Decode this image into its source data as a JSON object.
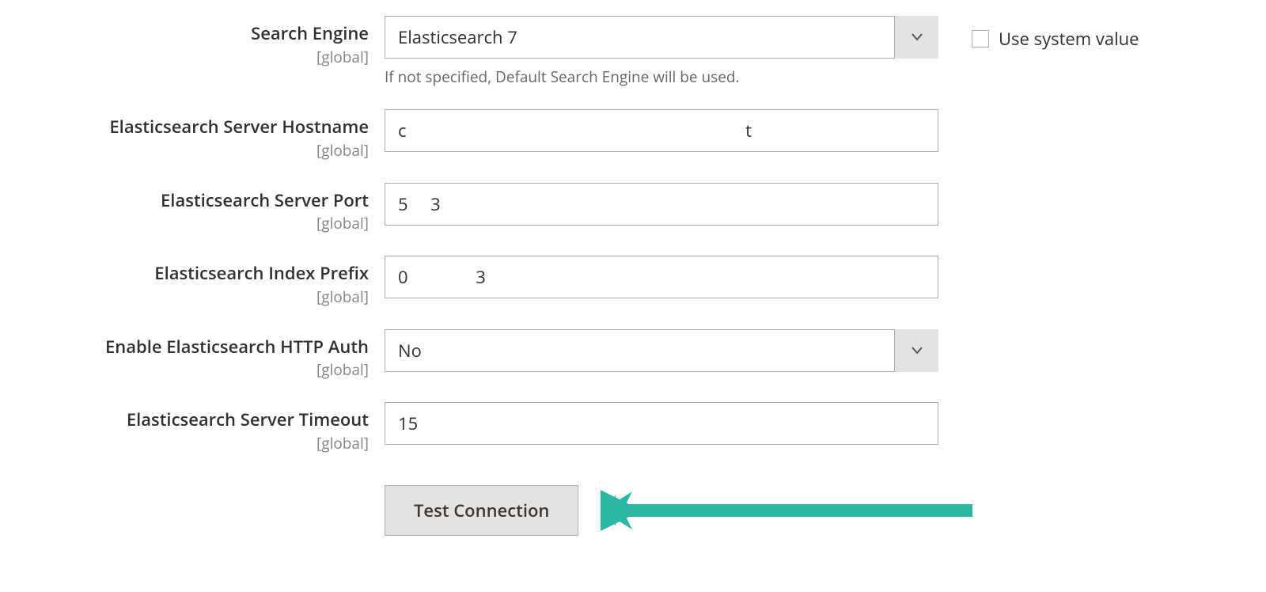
{
  "fields": {
    "search_engine": {
      "label": "Search Engine",
      "scope": "[global]",
      "value": "Elasticsearch 7",
      "helper": "If not specified, Default Search Engine will be used."
    },
    "hostname": {
      "label": "Elasticsearch Server Hostname",
      "scope": "[global]",
      "value": "c                                                                           t"
    },
    "port": {
      "label": "Elasticsearch Server Port",
      "scope": "[global]",
      "value": "5     3"
    },
    "index_prefix": {
      "label": "Elasticsearch Index Prefix",
      "scope": "[global]",
      "value": "0               3"
    },
    "http_auth": {
      "label": "Enable Elasticsearch HTTP Auth",
      "scope": "[global]",
      "value": "No"
    },
    "timeout": {
      "label": "Elasticsearch Server Timeout",
      "scope": "[global]",
      "value": "15"
    }
  },
  "use_system_value": {
    "label": "Use system value"
  },
  "test_button": {
    "label": "Test Connection"
  }
}
